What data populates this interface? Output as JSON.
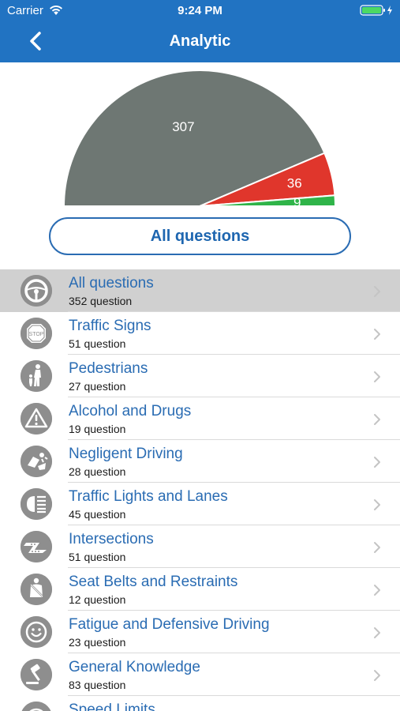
{
  "status_bar": {
    "carrier": "Carrier",
    "time": "9:24 PM"
  },
  "nav": {
    "title": "Analytic",
    "back_icon": "chevron-left-icon"
  },
  "chart_data": {
    "type": "pie",
    "shape": "semicircle",
    "slices": [
      {
        "value": 307,
        "label": "307",
        "color": "#6e7773"
      },
      {
        "value": 36,
        "label": "36",
        "color": "#e0362c"
      },
      {
        "value": 9,
        "label": "9",
        "color": "#2fb449"
      }
    ]
  },
  "filter_button": {
    "label": "All questions"
  },
  "list": [
    {
      "title": "All questions",
      "subtitle": "352 question",
      "icon": "steering-wheel-icon",
      "selected": true
    },
    {
      "title": "Traffic Signs",
      "subtitle": "51 question",
      "icon": "stop-sign-icon"
    },
    {
      "title": "Pedestrians",
      "subtitle": "27 question",
      "icon": "pedestrian-icon"
    },
    {
      "title": "Alcohol and Drugs",
      "subtitle": "19 question",
      "icon": "warning-icon"
    },
    {
      "title": "Negligent Driving",
      "subtitle": "28 question",
      "icon": "crash-icon"
    },
    {
      "title": "Traffic Lights and Lanes",
      "subtitle": "45 question",
      "icon": "headlight-icon"
    },
    {
      "title": "Intersections",
      "subtitle": "51 question",
      "icon": "intersection-icon"
    },
    {
      "title": "Seat Belts and Restraints",
      "subtitle": "12 question",
      "icon": "seatbelt-icon"
    },
    {
      "title": "Fatigue and Defensive Driving",
      "subtitle": "23 question",
      "icon": "smiley-icon"
    },
    {
      "title": "General Knowledge",
      "subtitle": "83 question",
      "icon": "gavel-icon"
    },
    {
      "title": "Speed Limits",
      "subtitle": "",
      "icon": "speedometer-icon"
    }
  ],
  "colors": {
    "nav_background": "#2173c2",
    "accent_blue": "#2a6cb3",
    "selected_row": "#d0d0d0",
    "icon_gray": "#8e8e8e"
  }
}
